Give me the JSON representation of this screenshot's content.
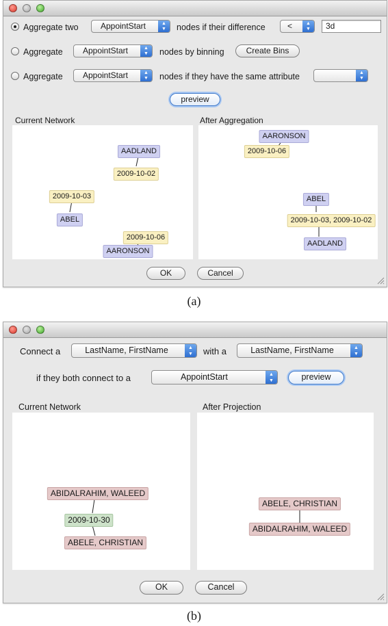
{
  "dialog_a": {
    "row1": {
      "label_aggregate": "Aggregate two",
      "attribute": "AppointStart",
      "label_nodes": "nodes if their difference",
      "operator": "<",
      "value": "3d"
    },
    "row2": {
      "label_aggregate": "Aggregate",
      "attribute": "AppointStart",
      "label_nodes": "nodes by binning",
      "create_bins": "Create Bins"
    },
    "row3": {
      "label_aggregate": "Aggregate",
      "attribute": "AppointStart",
      "label_nodes": "nodes if they have the same attribute",
      "attribute2": ""
    },
    "preview": "preview",
    "current_title": "Current Network",
    "after_title": "After Aggregation",
    "current_nodes": [
      "AADLAND",
      "2009-10-02",
      "2009-10-03",
      "ABEL",
      "2009-10-06",
      "AARONSON"
    ],
    "after_nodes": [
      "AARONSON",
      "2009-10-06",
      "ABEL",
      "2009-10-03, 2009-10-02",
      "AADLAND"
    ],
    "ok": "OK",
    "cancel": "Cancel",
    "caption": "(a)"
  },
  "dialog_b": {
    "connect_label": "Connect a",
    "source": "LastName, FirstName",
    "with_label": "with a",
    "target": "LastName, FirstName",
    "both_label": "if they both connect to a",
    "via": "AppointStart",
    "preview": "preview",
    "current_title": "Current Network",
    "after_title": "After Projection",
    "current_nodes": [
      "ABIDALRAHIM, WALEED",
      "2009-10-30",
      "ABELE, CHRISTIAN"
    ],
    "after_nodes": [
      "ABELE, CHRISTIAN",
      "ABIDALRAHIM, WALEED"
    ],
    "ok": "OK",
    "cancel": "Cancel",
    "caption": "(b)"
  },
  "colors": {
    "name_node": "#cfd0f1",
    "date_node": "#faf0c2",
    "person_node": "#e5c9c9",
    "date_node_b": "#cde2c9",
    "select_arrow": "#2f6fd1"
  }
}
